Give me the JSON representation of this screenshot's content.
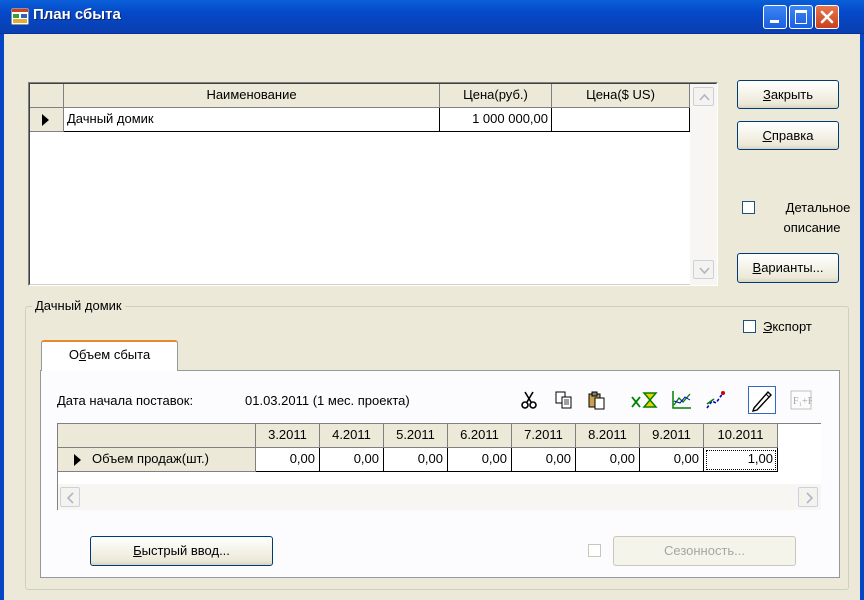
{
  "window": {
    "title": "План сбыта"
  },
  "products_table": {
    "columns": [
      "Наименование",
      "Цена(руб.)",
      "Цена($ US)"
    ],
    "rows": [
      {
        "name": "Дачный домик",
        "price_rub": "1 000 000,00",
        "price_usd": ""
      }
    ]
  },
  "buttons": {
    "close": {
      "accel": "З",
      "rest": "акрыть"
    },
    "help": {
      "accel": "С",
      "rest": "правка"
    },
    "variants": {
      "accel": "В",
      "rest": "арианты..."
    },
    "quick_input": {
      "accel": "Б",
      "rest": "ыстрый ввод..."
    },
    "seasonality": "Сезонность..."
  },
  "checkboxes": {
    "detailed": {
      "accel": "Д",
      "rest": "етальное",
      "line2": "описание"
    },
    "export": {
      "accel": "Э",
      "rest": "кспорт"
    }
  },
  "group": {
    "label": "Дачный домик"
  },
  "tab": {
    "label_pre": "О",
    "label_accel": "б",
    "label_post": "ъем сбыта"
  },
  "supply": {
    "start_label": "Дата начала поставок:",
    "start_value": "01.03.2011 (1 мес. проекта)"
  },
  "volume_table": {
    "months": [
      "3.2011",
      "4.2011",
      "5.2011",
      "6.2011",
      "7.2011",
      "8.2011",
      "9.2011",
      "10.2011"
    ],
    "row_label": "Объем продаж(шт.)",
    "values": [
      "0,00",
      "0,00",
      "0,00",
      "0,00",
      "0,00",
      "0,00",
      "0,00",
      "1,00"
    ]
  },
  "toolbar_icons": [
    "cut-icon",
    "copy-icon",
    "paste-icon",
    "fill-icon",
    "chart-icon",
    "trend-icon",
    "pencil-icon",
    "formula-icon"
  ],
  "colors": {
    "titlebar": "#0548c8",
    "face": "#ece9d8",
    "tab_accent": "#e68b2c"
  }
}
